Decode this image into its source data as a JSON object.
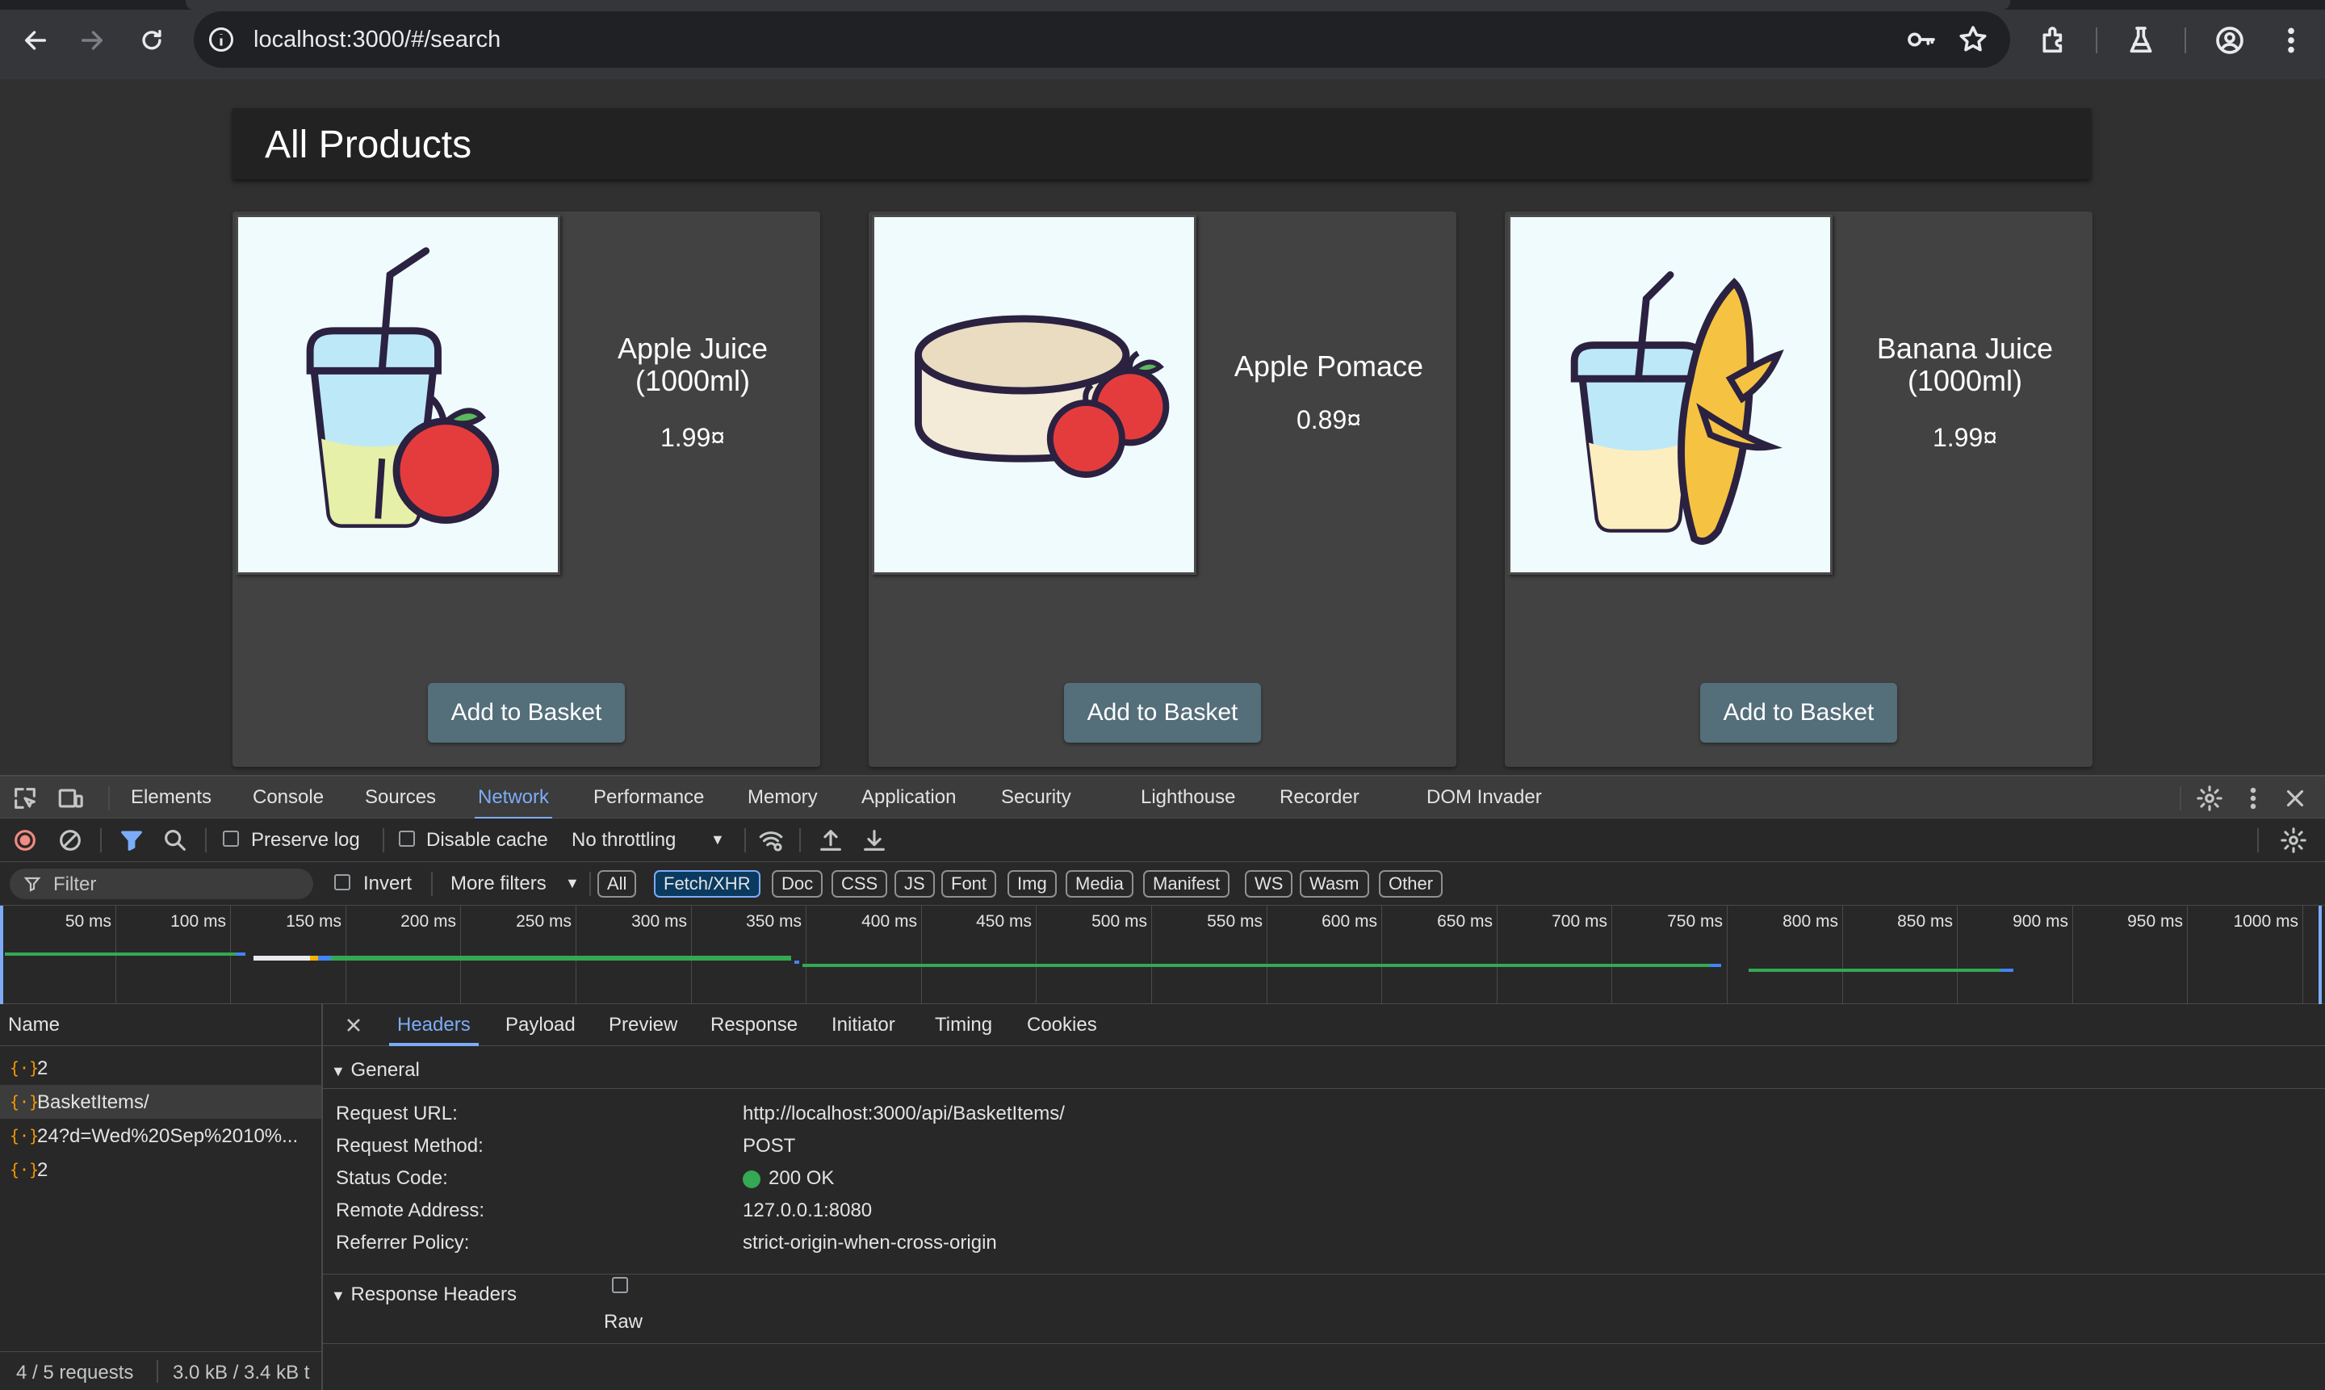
{
  "browser": {
    "url": "localhost:3000/#/search",
    "icons": [
      "back-icon",
      "forward-icon",
      "reload-icon",
      "site-info-icon",
      "password-key-icon",
      "bookmark-star-icon",
      "extensions-icon",
      "labs-flask-icon",
      "profile-icon",
      "menu-icon"
    ]
  },
  "page": {
    "title": "All Products",
    "products": [
      {
        "name": "Apple Juice (1000ml)",
        "price": "1.99¤",
        "button": "Add to Basket"
      },
      {
        "name": "Apple Pomace",
        "price": "0.89¤",
        "button": "Add to Basket"
      },
      {
        "name": "Banana Juice (1000ml)",
        "price": "1.99¤",
        "button": "Add to Basket"
      }
    ]
  },
  "devtools": {
    "tabs": [
      "Elements",
      "Console",
      "Sources",
      "Network",
      "Performance",
      "Memory",
      "Application",
      "Security",
      "Lighthouse",
      "Recorder",
      "DOM Invader"
    ],
    "active_tab": "Network",
    "toolbar": {
      "preserve_log": "Preserve log",
      "disable_cache": "Disable cache",
      "throttling": "No throttling"
    },
    "filter": {
      "placeholder": "Filter",
      "invert": "Invert",
      "more_filters": "More filters",
      "types": [
        "All",
        "Fetch/XHR",
        "Doc",
        "CSS",
        "JS",
        "Font",
        "Img",
        "Media",
        "Manifest",
        "WS",
        "Wasm",
        "Other"
      ],
      "selected_type": "Fetch/XHR"
    },
    "timeline_ticks": [
      "50 ms",
      "100 ms",
      "150 ms",
      "200 ms",
      "250 ms",
      "300 ms",
      "350 ms",
      "400 ms",
      "450 ms",
      "500 ms",
      "550 ms",
      "600 ms",
      "650 ms",
      "700 ms",
      "750 ms",
      "800 ms",
      "850 ms",
      "900 ms",
      "950 ms",
      "1000 ms"
    ],
    "requests": {
      "column": "Name",
      "items": [
        "2",
        "BasketItems/",
        "24?d=Wed%20Sep%2010%...",
        "2"
      ],
      "selected_index": 1,
      "summary": "4 / 5 requests",
      "transfer": "3.0 kB / 3.4 kB t"
    },
    "detail": {
      "tabs": [
        "Headers",
        "Payload",
        "Preview",
        "Response",
        "Initiator",
        "Timing",
        "Cookies"
      ],
      "active_tab": "Headers",
      "general_title": "General",
      "general": [
        {
          "k": "Request URL:",
          "v": "http://localhost:3000/api/BasketItems/"
        },
        {
          "k": "Request Method:",
          "v": "POST"
        },
        {
          "k": "Status Code:",
          "v": "200 OK"
        },
        {
          "k": "Remote Address:",
          "v": "127.0.0.1:8080"
        },
        {
          "k": "Referrer Policy:",
          "v": "strict-origin-when-cross-origin"
        }
      ],
      "response_headers_title": "Response Headers",
      "raw_label": "Raw"
    }
  },
  "colors": {
    "accent": "#7cacf8",
    "button": "#546e7a",
    "status_ok": "#34a853"
  }
}
